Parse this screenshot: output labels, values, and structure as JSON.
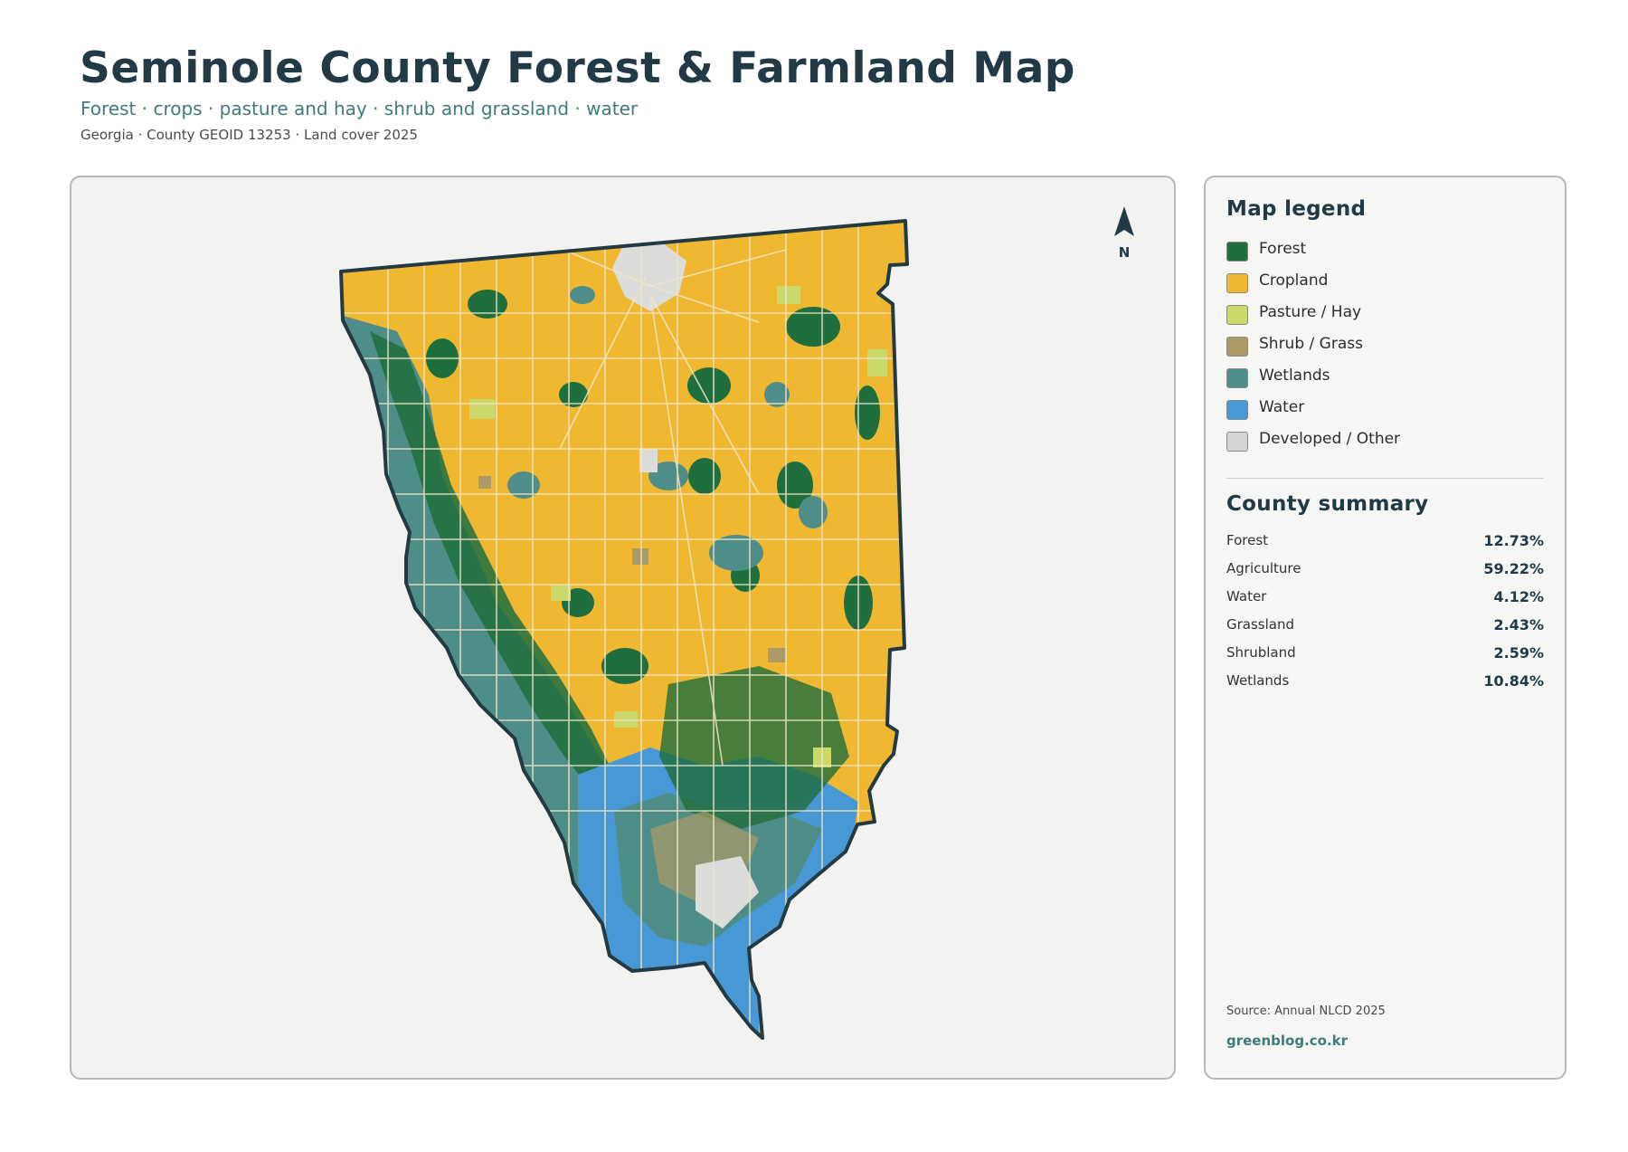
{
  "header": {
    "title": "Seminole County Forest & Farmland Map",
    "subtitle": "Forest · crops · pasture and hay · shrub and grassland · water",
    "meta": "Georgia · County GEOID 13253 · Land cover 2025"
  },
  "map": {
    "north_label": "N",
    "colors": {
      "forest": "#1f6e3d",
      "cropland": "#f0b830",
      "pasture": "#cbd86a",
      "shrub": "#ab9a66",
      "wetlands": "#4f8e88",
      "water": "#4898d6",
      "developed": "#dcdcdb",
      "boundary": "#243a42",
      "roads": "#efe6c8"
    }
  },
  "legend": {
    "title": "Map legend",
    "items": [
      {
        "label": "Forest",
        "color": "#1f6e3d"
      },
      {
        "label": "Cropland",
        "color": "#f0b830"
      },
      {
        "label": "Pasture / Hay",
        "color": "#cbd86a"
      },
      {
        "label": "Shrub / Grass",
        "color": "#ab9a66"
      },
      {
        "label": "Wetlands",
        "color": "#4f8e88"
      },
      {
        "label": "Water",
        "color": "#4898d6"
      },
      {
        "label": "Developed / Other",
        "color": "#d4d4d2"
      }
    ]
  },
  "summary": {
    "title": "County summary",
    "rows": [
      {
        "label": "Forest",
        "value": "12.73%"
      },
      {
        "label": "Agriculture",
        "value": "59.22%"
      },
      {
        "label": "Water",
        "value": "4.12%"
      },
      {
        "label": "Grassland",
        "value": "2.43%"
      },
      {
        "label": "Shrubland",
        "value": "2.59%"
      },
      {
        "label": "Wetlands",
        "value": "10.84%"
      }
    ]
  },
  "footer": {
    "source": "Source: Annual NLCD 2025",
    "site": "greenblog.co.kr"
  }
}
